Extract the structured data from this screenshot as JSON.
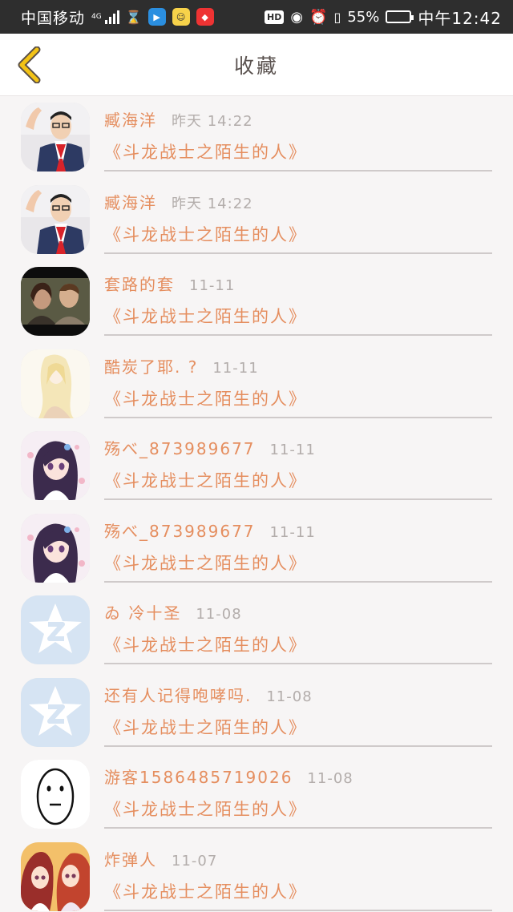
{
  "status_bar": {
    "carrier": "中国移动",
    "network": "4G",
    "hd": "HD",
    "battery_level_percent": 55,
    "battery_text": "55%",
    "time": "中午12:42"
  },
  "header": {
    "title": "收藏"
  },
  "favorites": [
    {
      "name": "臧海洋",
      "time": "昨天  14:22",
      "title": "《斗龙战士之陌生的人》",
      "avatar": "photo-boy"
    },
    {
      "name": "臧海洋",
      "time": "昨天  14:22",
      "title": "《斗龙战士之陌生的人》",
      "avatar": "photo-boy"
    },
    {
      "name": "套路的套",
      "time": "11-11",
      "title": "《斗龙战士之陌生的人》",
      "avatar": "movie-couple"
    },
    {
      "name": "酷炭了耶. ?",
      "time": "11-11",
      "title": "《斗龙战士之陌生的人》",
      "avatar": "sketch-girl"
    },
    {
      "name": "殇べ_873989677",
      "time": "11-11",
      "title": "《斗龙战士之陌生的人》",
      "avatar": "anime-girl"
    },
    {
      "name": "殇べ_873989677",
      "time": "11-11",
      "title": "《斗龙战士之陌生的人》",
      "avatar": "anime-girl"
    },
    {
      "name": "ゐ 冷十圣",
      "time": "11-08",
      "title": "《斗龙战士之陌生的人》",
      "avatar": "qzone-default"
    },
    {
      "name": "还有人记得咆哮吗.",
      "time": "11-08",
      "title": "《斗龙战士之陌生的人》",
      "avatar": "qzone-default"
    },
    {
      "name": "游客1586485719026",
      "time": "11-08",
      "title": "《斗龙战士之陌生的人》",
      "avatar": "face-drawing"
    },
    {
      "name": "炸弹人",
      "time": "11-07",
      "title": "《斗龙战士之陌生的人》",
      "avatar": "anime-pair"
    }
  ],
  "colors": {
    "accent": "#e58e5f",
    "muted": "#b3adab",
    "back_arrow": "#f3c316"
  }
}
